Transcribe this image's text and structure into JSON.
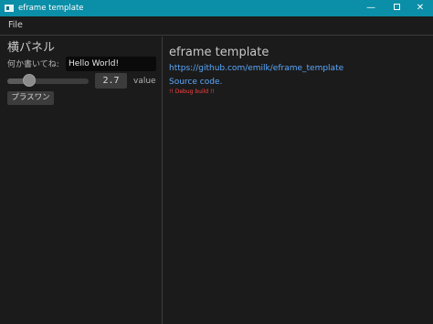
{
  "window": {
    "title": "eframe template",
    "controls": {
      "minimize": "—",
      "close": "✕"
    }
  },
  "menu": {
    "file": "File"
  },
  "side_panel": {
    "heading": "横パネル",
    "text_label": "何か書いてね:",
    "text_value": "Hello World!",
    "slider": {
      "value": "2.7",
      "fraction": 0.27,
      "label": "value"
    },
    "increment_button": "プラスワン"
  },
  "central": {
    "heading": "eframe template",
    "repo_link": "https://github.com/emilk/eframe_template",
    "source_link": "Source code.",
    "debug_warning": "!! Debug build !!"
  }
}
